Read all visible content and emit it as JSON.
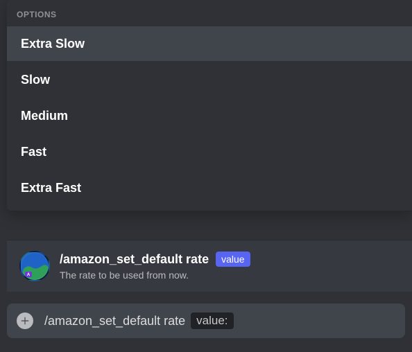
{
  "options": {
    "header": "OPTIONS",
    "items": [
      {
        "label": "Extra Slow",
        "selected": true
      },
      {
        "label": "Slow",
        "selected": false
      },
      {
        "label": "Medium",
        "selected": false
      },
      {
        "label": "Fast",
        "selected": false
      },
      {
        "label": "Extra Fast",
        "selected": false
      }
    ]
  },
  "command_hint": {
    "command": "/amazon_set_default rate",
    "param_pill": "value",
    "description": "The rate to be used from now."
  },
  "input": {
    "command_text": "/amazon_set_default rate",
    "active_param": "value:"
  }
}
